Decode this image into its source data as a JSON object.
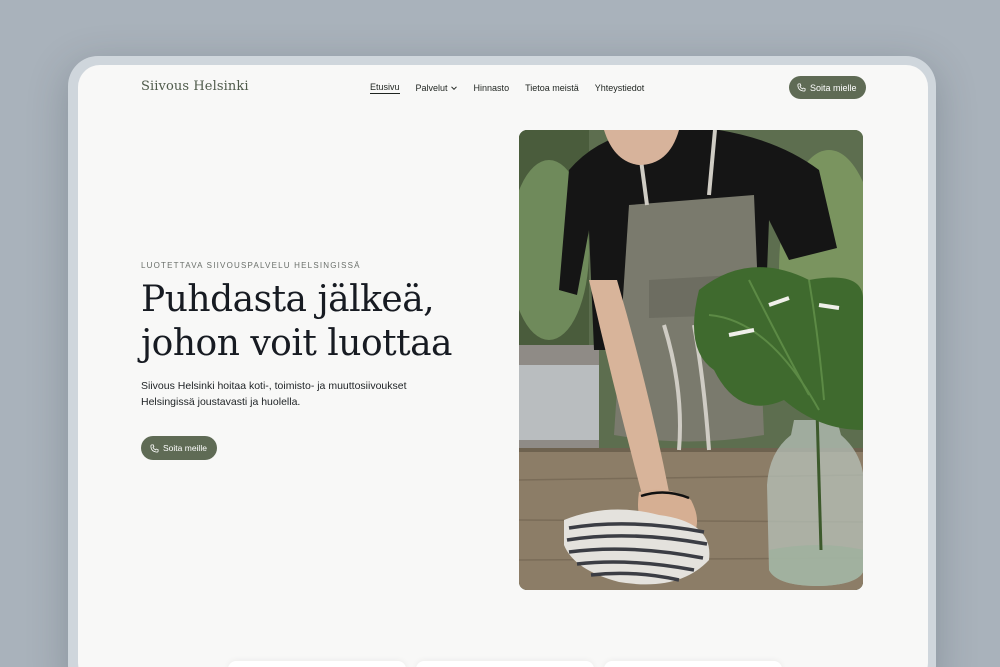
{
  "nav": {
    "brand": "Siivous Helsinki",
    "items": [
      {
        "label": "Etusivu",
        "active": true
      },
      {
        "label": "Palvelut",
        "has_dropdown": true
      },
      {
        "label": "Hinnasto"
      },
      {
        "label": "Tietoa meistä"
      },
      {
        "label": "Yhteystiedot"
      }
    ],
    "cta_label": "Soita mielle"
  },
  "hero": {
    "eyebrow": "LUOTETTAVA SIIVOUSPALVELU HELSINGISSÄ",
    "title_lines": [
      "Puhdasta jälkeä,",
      "johon voit luottaa"
    ],
    "lead": "Siivous Helsinki hoitaa koti-, toimisto- ja muuttosiivoukset Helsingissä joustavasti ja huolella.",
    "cta_label": "Soita meille",
    "image_icon": "photo-cleaning-table"
  },
  "icons": {
    "phone": "phone-icon",
    "chevron": "chevron-down-icon"
  },
  "colors": {
    "accent": "#5f6b55",
    "background": "#f8f8f7",
    "text": "#171b22",
    "frame": "#a9b2bb"
  }
}
